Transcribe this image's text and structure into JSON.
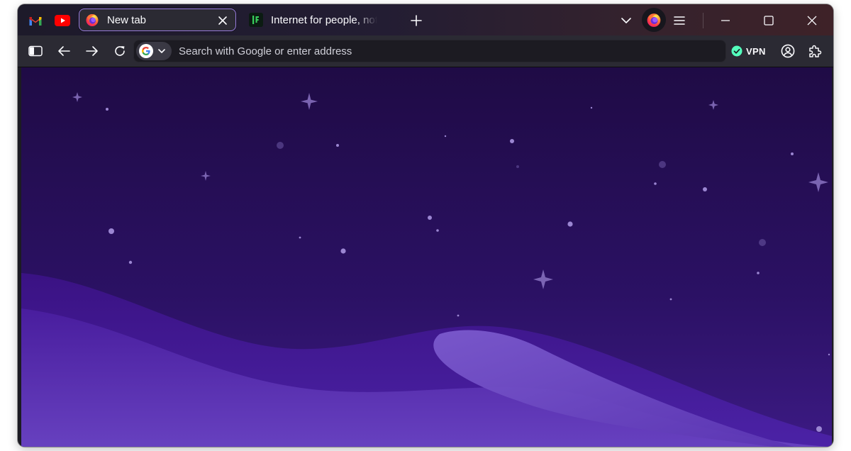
{
  "window": {
    "title": "New tab"
  },
  "pinned_tabs": [
    {
      "name": "Gmail",
      "icon": "gmail-icon",
      "color": "#ea4335"
    },
    {
      "name": "YouTube",
      "icon": "youtube-icon",
      "color": "#ff0000"
    }
  ],
  "tabs": [
    {
      "title": "New tab",
      "icon": "firefox-icon",
      "active": true
    },
    {
      "title": "Internet for people, not profit",
      "icon": "mozilla-icon",
      "active": false
    }
  ],
  "toolbar": {
    "new_tab_icon": "plus-icon",
    "list_all_tabs_icon": "chevron-down-icon",
    "firefox_view_icon": "firefox-icon",
    "menu_icon": "hamburger-menu-icon",
    "minimize_icon": "minimize-icon",
    "maximize_icon": "maximize-icon",
    "close_icon": "close-icon"
  },
  "navbar": {
    "sidebar_icon": "sidebar-icon",
    "back_icon": "arrow-left-icon",
    "forward_icon": "arrow-right-icon",
    "reload_icon": "reload-icon",
    "search_engine": "Google",
    "url_placeholder": "Search with Google or enter address",
    "url_value": "",
    "vpn_label": "VPN",
    "vpn_status_color": "#54ffbd",
    "account_icon": "account-icon",
    "extensions_icon": "puzzle-piece-icon"
  },
  "theme": {
    "accent": "#9a7ee0",
    "sky_top": "#1f0b45",
    "sky_bottom": "#3c1a84",
    "hill_light": "#6a4bc0"
  }
}
